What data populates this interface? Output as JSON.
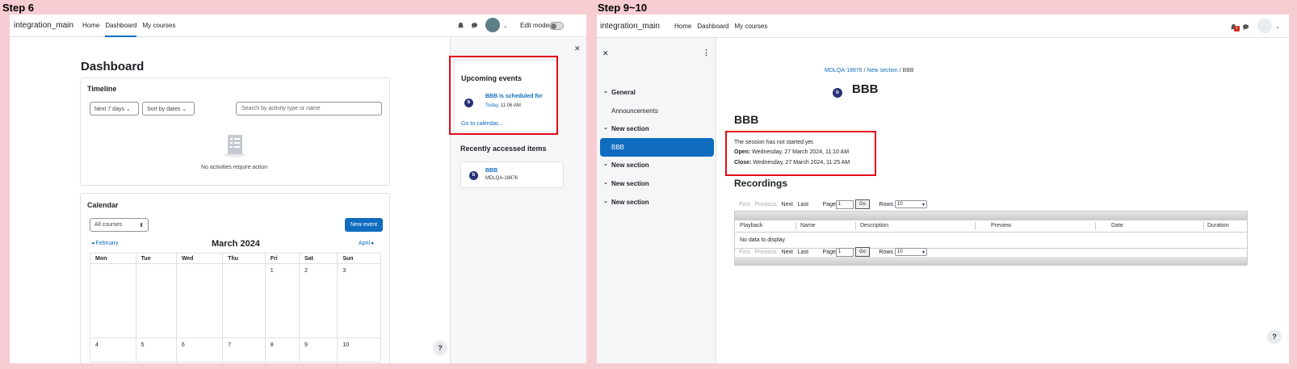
{
  "step6": {
    "label": "Step 6",
    "brand": "integration_main",
    "nav": [
      "Home",
      "Dashboard",
      "My courses"
    ],
    "edit_mode": "Edit mode",
    "page_title": "Dashboard",
    "timeline": {
      "title": "Timeline",
      "filter_days": "Next 7 days",
      "sort": "Sort by dates",
      "search_placeholder": "Search by activity type or name",
      "empty": "No activities require action"
    },
    "calendar": {
      "title": "Calendar",
      "course_select": "All courses",
      "new_event": "New event",
      "prev": "February",
      "month": "March 2024",
      "next": "April",
      "days": [
        "Mon",
        "Tue",
        "Wed",
        "Thu",
        "Fri",
        "Sat",
        "Sun"
      ],
      "row1": [
        "",
        "",
        "",
        "",
        "1",
        "2",
        "3"
      ],
      "row2": [
        "4",
        "5",
        "6",
        "7",
        "8",
        "9",
        "10"
      ]
    },
    "upcoming": {
      "title": "Upcoming events",
      "event_title": "BBB is scheduled for",
      "event_day": "Today",
      "event_time": ", 11:06 AM",
      "goto": "Go to calendar..."
    },
    "recent": {
      "title": "Recently accessed items",
      "item_name": "BBB",
      "item_course": "MDLQA-18876"
    },
    "help": "?"
  },
  "step9": {
    "label": "Step 9~10",
    "brand": "integration_main",
    "nav": [
      "Home",
      "Dashboard",
      "My courses"
    ],
    "notification_count": "1",
    "sidebar": [
      {
        "label": "General",
        "type": "section"
      },
      {
        "label": "Announcements",
        "type": "item"
      },
      {
        "label": "New section",
        "type": "section"
      },
      {
        "label": "BBB",
        "type": "active"
      },
      {
        "label": "New section",
        "type": "section"
      },
      {
        "label": "New section",
        "type": "section"
      },
      {
        "label": "New section",
        "type": "section"
      }
    ],
    "breadcrumb": [
      "MDLQA-18876",
      "New section",
      "BBB"
    ],
    "activity_title": "BBB",
    "section_title": "BBB",
    "session_status": "The session has not started yet.",
    "open_label": "Open:",
    "open_value": " Wednesday, 27 March 2024, 11:10 AM",
    "close_label": "Close:",
    "close_value": " Wednesday, 27 March 2024, 11:25 AM",
    "recordings_title": "Recordings",
    "pager": {
      "first": "First",
      "previous": "Previous",
      "next": "Next",
      "last": "Last",
      "page": "Page",
      "page_value": "1",
      "go": "Go",
      "rows": "Rows",
      "rows_value": "10"
    },
    "columns": [
      "Playback",
      "Name",
      "Description",
      "Preview",
      "Date",
      "Duration"
    ],
    "empty": "No data to display",
    "help": "?"
  }
}
